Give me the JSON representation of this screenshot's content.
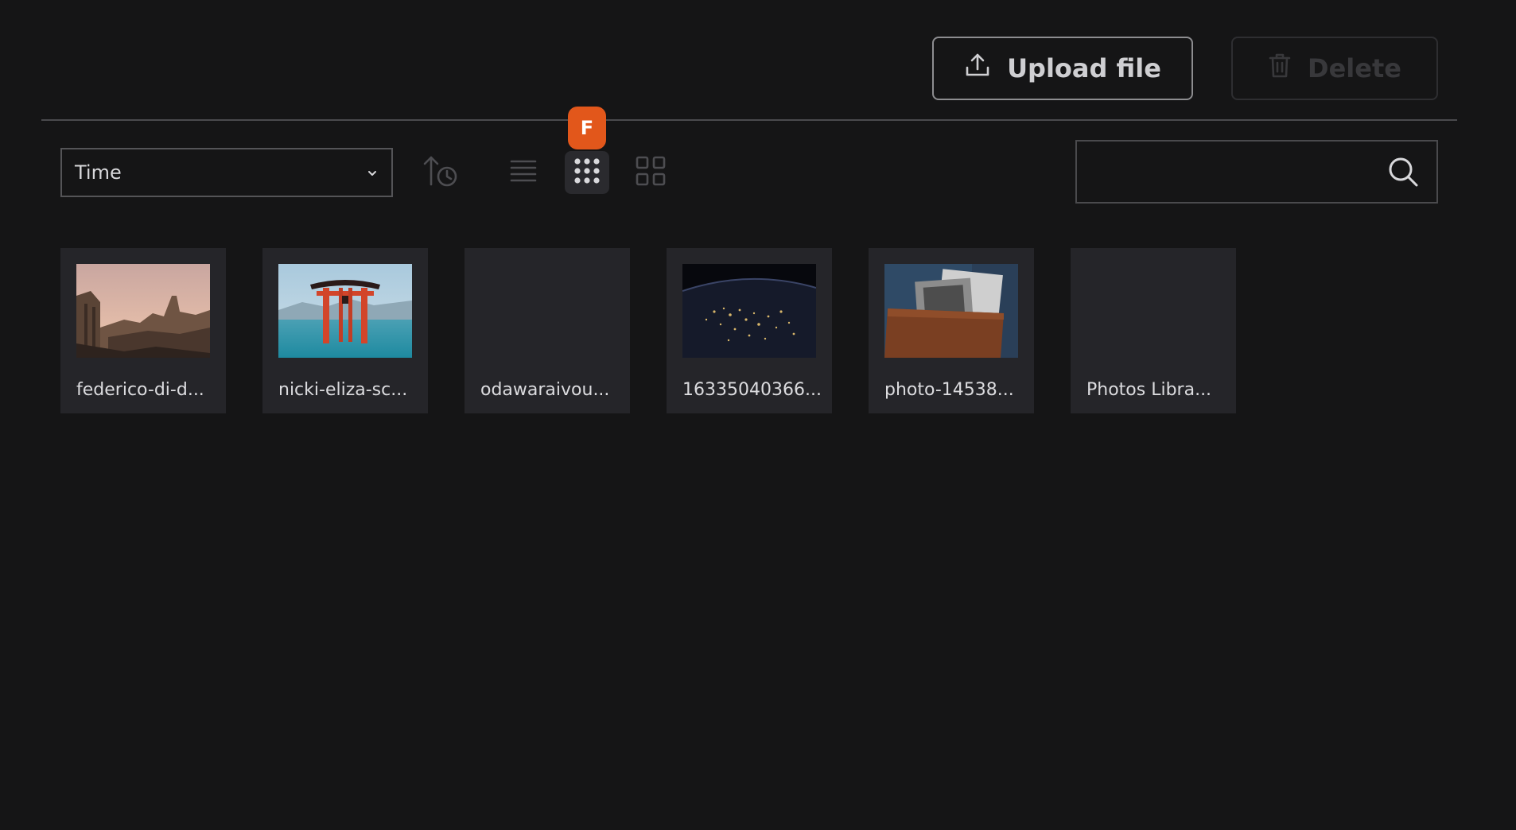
{
  "toolbar": {
    "upload_label": "Upload file",
    "delete_label": "Delete"
  },
  "controls": {
    "sort_select_value": "Time",
    "active_view": "grid-small",
    "view_badge_letter": "F",
    "search_placeholder": ""
  },
  "files": [
    {
      "name": "federico-di-d...",
      "thumbnail": "ruins-at-sunset"
    },
    {
      "name": "nicki-eliza-sc...",
      "thumbnail": "torii-gate-in-water"
    },
    {
      "name": "odawaraivou...",
      "thumbnail": ""
    },
    {
      "name": "16335040366...",
      "thumbnail": "earth-at-night"
    },
    {
      "name": "photo-14538...",
      "thumbnail": "box-of-photographs"
    },
    {
      "name": "Photos Libra...",
      "thumbnail": ""
    }
  ],
  "colors": {
    "background": "#151516",
    "card": "#252529",
    "accent_badge": "#e2571b"
  }
}
